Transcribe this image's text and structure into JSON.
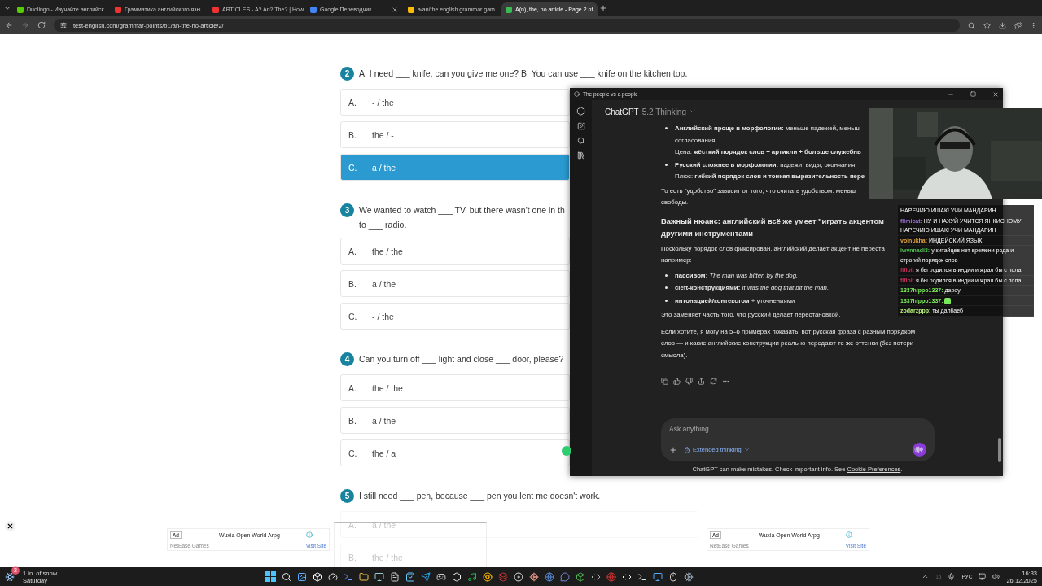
{
  "browser": {
    "tabs": [
      {
        "title": "Duolingo - Изучайте английск",
        "selected": false
      },
      {
        "title": "Грамматика английского язы",
        "selected": false
      },
      {
        "title": "ARTICLES - A? An? The? | How",
        "selected": false
      },
      {
        "title": "Google Переводчик",
        "selected": false
      },
      {
        "title": "a/an/the english grammar gam",
        "selected": false
      },
      {
        "title": "A(n), the, no article - Page 2 of",
        "selected": true
      }
    ],
    "address": "test-english.com/grammar-points/b1/an-the-no-article/2/"
  },
  "quiz": [
    {
      "number": "2",
      "lines": [
        "A: I need ___ knife, can you give me one? B: You can use ___ knife on the kitchen top."
      ],
      "options": [
        {
          "letter": "A.",
          "text": "- / the",
          "selected": false
        },
        {
          "letter": "B.",
          "text": "the / -",
          "selected": false
        },
        {
          "letter": "C.",
          "text": "a / the",
          "selected": true
        }
      ]
    },
    {
      "number": "3",
      "lines": [
        "We wanted to watch ___ TV, but there wasn't one in th",
        "to ___ radio."
      ],
      "options": [
        {
          "letter": "A.",
          "text": "the / the",
          "selected": false
        },
        {
          "letter": "B.",
          "text": "a / the",
          "selected": false
        },
        {
          "letter": "C.",
          "text": "- / the",
          "selected": false
        }
      ]
    },
    {
      "number": "4",
      "lines": [
        "Can you turn off ___ light and close ___ door, please?"
      ],
      "options": [
        {
          "letter": "A.",
          "text": "the / the",
          "selected": false
        },
        {
          "letter": "B.",
          "text": "a / the",
          "selected": false
        },
        {
          "letter": "C.",
          "text": "the / a",
          "selected": false
        }
      ]
    },
    {
      "number": "5",
      "lines": [
        "I still need ___ pen, because ___ pen you lent me doesn't work."
      ],
      "options": [
        {
          "letter": "A.",
          "text": "a / the",
          "selected": false
        },
        {
          "letter": "B.",
          "text": "the / the",
          "selected": false
        }
      ]
    }
  ],
  "ads": [
    {
      "badge": "Ad",
      "title": "Wuxia Open World Arpg",
      "advertiser": "NetEase Games",
      "link": "Visit Site"
    },
    {
      "badge": "Ad",
      "title": "Wuxia Open World Arpg",
      "advertiser": "NetEase Games",
      "link": "Visit Site"
    }
  ],
  "chatgpt": {
    "window_title": "The people vs a people",
    "model": "ChatGPT",
    "version": "5.2 Thinking",
    "blocks": [
      {
        "kind": "bullet",
        "lines": [
          "**Английский проще в морфологии:** меньше падежей, меньш",
          "согласования.",
          "Цена: **жёсткий порядок слов + артикли + больше служебнь**"
        ]
      },
      {
        "kind": "bullet",
        "lines": [
          "**Русский сложнее в морфологии:** падежи, виды, окончания.",
          "Плюс: **гибкий порядок слов и тонкая выразительность пере**"
        ]
      },
      {
        "kind": "para",
        "lines": [
          "То есть \"удобство\" зависит от того, что считать удобством: меньш",
          "свободы."
        ]
      },
      {
        "kind": "heading",
        "lines": [
          "Важный нюанс: английский всё же умеет \"играть акцентом",
          "другими инструментами"
        ]
      },
      {
        "kind": "para",
        "lines": [
          "Поскольку порядок слов фиксирован, английский делает акцент не переста",
          "например:"
        ]
      },
      {
        "kind": "bullet",
        "lines": [
          "**пассивом:** *The man was bitten by the dog.*"
        ]
      },
      {
        "kind": "bullet",
        "lines": [
          "**cleft-конструкциями:** *It was the dog that bit the man.*"
        ]
      },
      {
        "kind": "bullet",
        "lines": [
          "**интонацией/контекстом** + уточнениями"
        ]
      },
      {
        "kind": "para",
        "lines": [
          "Это заменяет часть того, что русский делает перестановкой."
        ]
      },
      {
        "kind": "para",
        "lines": [
          "Если хотите, я могу на 5–6 примерах показать: вот русская фраза с разным порядком",
          "слов — и какие английские конструкции реально передают те же оттенки (без потери",
          "смысла)."
        ]
      }
    ],
    "input": {
      "placeholder": "Ask anything",
      "mode": "Extended thinking"
    },
    "disclaimer": "ChatGPT can make mistakes. Check important info. See",
    "disclaimer_link": "Cookie Preferences",
    "disclaimer_end": "."
  },
  "stream_chat": [
    {
      "kind": "continuation",
      "text": "НАРЕЧИЮ ИШАК! УЧИ МАНДАРИН"
    },
    {
      "kind": "message",
      "user": "flimicat:",
      "color": "#9a6fd0",
      "text": "НУ И НАХУЙ УЧИТСЯ ЯНКИСНОМУ НАРЕЧИЮ ИШАК! УЧИ МАНДАРИН"
    },
    {
      "kind": "message",
      "user": "volnukha:",
      "color": "#e0a040",
      "text": "ИНДЕЙСКИЙ ЯЗЫК"
    },
    {
      "kind": "message",
      "user": "iwvnnadi3:",
      "color": "#4fc04f",
      "text": "у китайцев нет времени рода и строгий порядок слов"
    },
    {
      "kind": "message",
      "user": "fifioi:",
      "color": "#c0305a",
      "text": "я бы родился в индии и жрал бы с пола"
    },
    {
      "kind": "message",
      "user": "fifioi:",
      "color": "#c0305a",
      "text": "я бы родился в индии и жрал бы с пола"
    },
    {
      "kind": "message",
      "user": "1337hippo1337:",
      "color": "#7be85a",
      "text": "дароу"
    },
    {
      "kind": "emote",
      "user": "1337hippo1337:",
      "color": "#7be85a"
    },
    {
      "kind": "message",
      "user": "zodarzppp:",
      "color": "#b6f07a",
      "text": "ты далбаеб"
    }
  ],
  "taskbar": {
    "weather": {
      "badge": "2",
      "title": "1 in. of snow",
      "subtitle": "Saturday"
    },
    "tray": {
      "count": "15",
      "language": "РУС",
      "time": "16:33",
      "date": "26.12.2025"
    }
  }
}
